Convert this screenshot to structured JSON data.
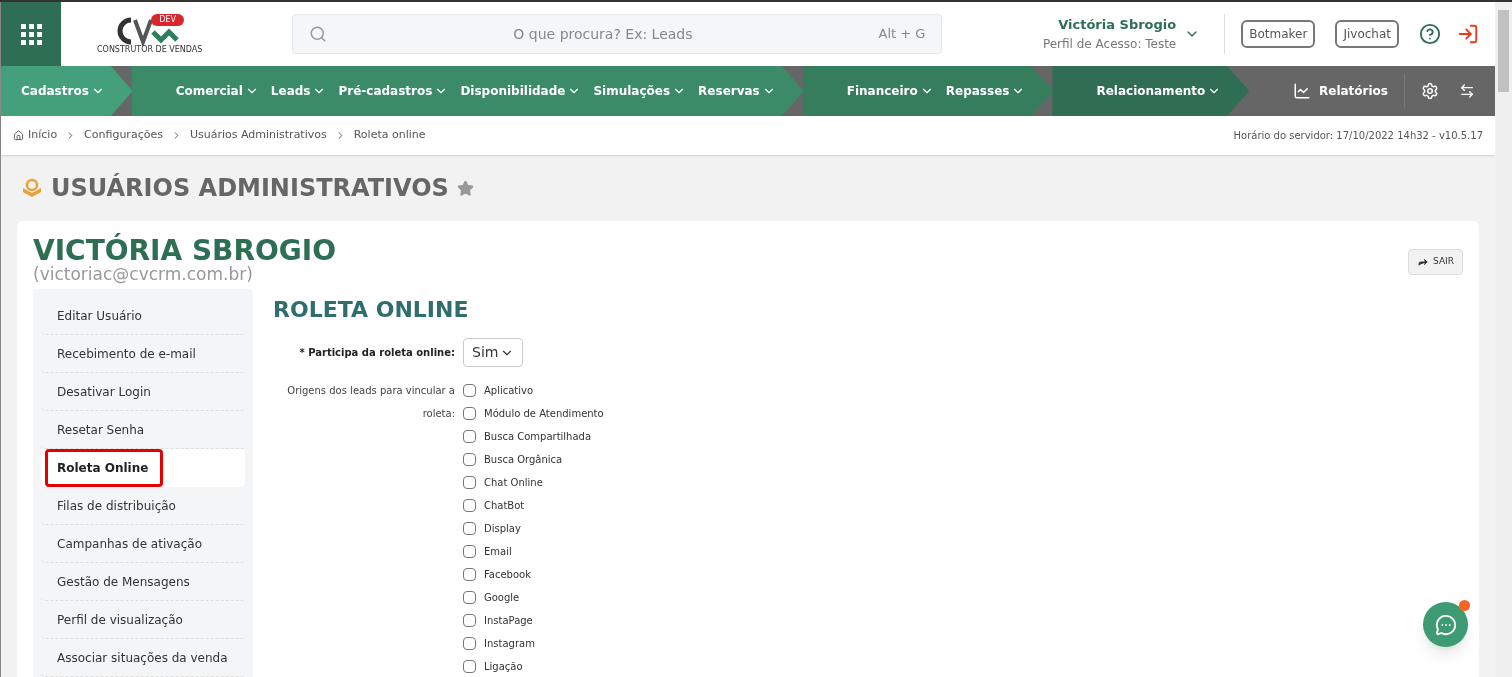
{
  "header": {
    "logo_badge": "DEV",
    "logo_tagline": "CONSTRUTOR DE VENDAS",
    "search": {
      "placeholder": "O que procura? Ex: Leads",
      "shortcut": "Alt + G"
    },
    "user": {
      "name": "Victória Sbrogio",
      "profile": "Perfil de Acesso: Teste"
    },
    "buttons": [
      "Botmaker",
      "Jivochat"
    ]
  },
  "nav": {
    "groups": [
      {
        "color": "#43a07a",
        "items": [
          "Cadastros"
        ]
      },
      {
        "color": "#3b8b68",
        "items": [
          "Comercial",
          "Leads",
          "Pré-cadastros",
          "Disponibilidade",
          "Simulações",
          "Reservas"
        ]
      },
      {
        "color": "#367d5e",
        "items": [
          "Financeiro",
          "Repasses"
        ]
      },
      {
        "color": "#2f6e52",
        "items": [
          "Relacionamento"
        ]
      }
    ],
    "reports": "Relatórios"
  },
  "breadcrumb": [
    "Início",
    "Configurações",
    "Usuários Administrativos",
    "Roleta online"
  ],
  "server_info": "Horário do servidor: 17/10/2022 14h32 - v10.5.17",
  "page_title": "USUÁRIOS ADMINISTRATIVOS",
  "user_card": {
    "name": "VICTÓRIA SBROGIO",
    "email": "(victoriac@cvcrm.com.br)",
    "exit_button": "SAIR"
  },
  "sidebar": {
    "items": [
      {
        "label": "Editar Usuário",
        "selected": false
      },
      {
        "label": "Recebimento de e-mail",
        "selected": false
      },
      {
        "label": "Desativar Login",
        "selected": false
      },
      {
        "label": "Resetar Senha",
        "selected": false
      },
      {
        "label": "Roleta Online",
        "selected": true
      },
      {
        "label": "Filas de distribuição",
        "selected": false
      },
      {
        "label": "Campanhas de ativação",
        "selected": false
      },
      {
        "label": "Gestão de Mensagens",
        "selected": false
      },
      {
        "label": "Perfil de visualização",
        "selected": false
      },
      {
        "label": "Associar situações da venda",
        "selected": false
      }
    ]
  },
  "section": {
    "title": "ROLETA ONLINE",
    "participa": {
      "label": "Participa da roleta online:",
      "required_mark": "*",
      "value": "Sim"
    },
    "origins_label": "Origens dos leads para vincular a roleta:",
    "origins": [
      {
        "label": "Aplicativo",
        "checked": false
      },
      {
        "label": "Módulo de Atendimento",
        "checked": false
      },
      {
        "label": "Busca Compartilhada",
        "checked": false
      },
      {
        "label": "Busca Orgânica",
        "checked": false
      },
      {
        "label": "Chat Online",
        "checked": false
      },
      {
        "label": "ChatBot",
        "checked": false
      },
      {
        "label": "Display",
        "checked": false
      },
      {
        "label": "Email",
        "checked": false
      },
      {
        "label": "Facebook",
        "checked": false
      },
      {
        "label": "Google",
        "checked": false
      },
      {
        "label": "InstaPage",
        "checked": false
      },
      {
        "label": "Instagram",
        "checked": false
      },
      {
        "label": "Ligação",
        "checked": false
      }
    ]
  },
  "chat_widget": {
    "unread": true
  }
}
